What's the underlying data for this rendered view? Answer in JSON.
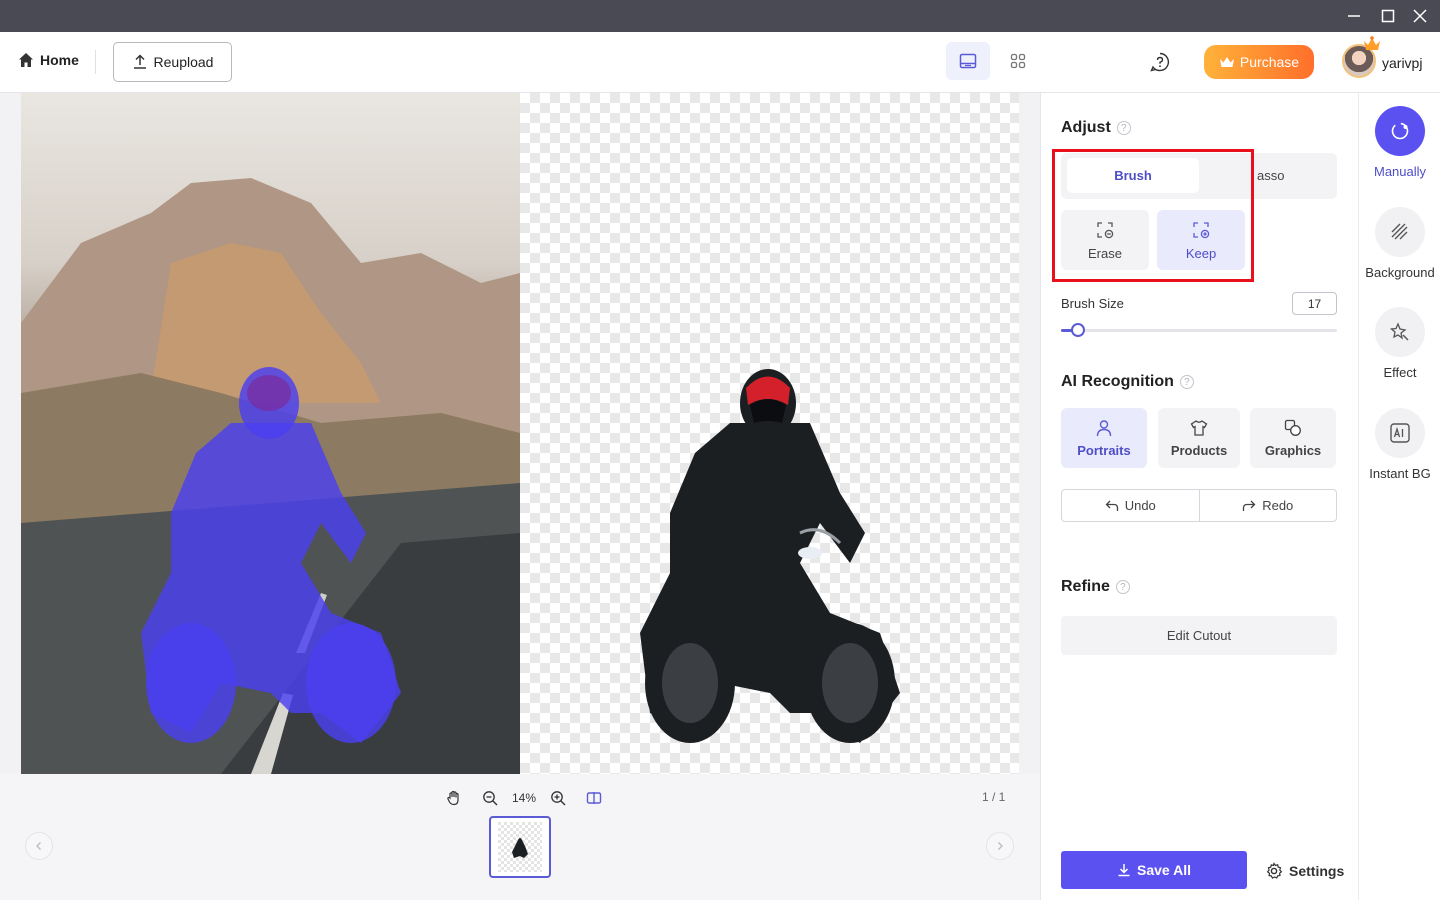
{
  "toolbar": {
    "home_label": "Home",
    "reupload_label": "Reupload",
    "purchase_label": "Purchase",
    "username": "yarivpj"
  },
  "canvas": {
    "zoom": "14%",
    "page_count": "1 / 1"
  },
  "adjust": {
    "title": "Adjust",
    "tabs": [
      {
        "label": "Brush",
        "selected": true
      },
      {
        "label": "asso",
        "selected": false
      }
    ],
    "modes": [
      {
        "label": "Erase",
        "selected": false
      },
      {
        "label": "Keep",
        "selected": true
      }
    ],
    "brush_size_label": "Brush Size",
    "brush_size_value": "17",
    "brush_size_fraction": 0.06
  },
  "ai": {
    "title": "AI Recognition",
    "options": [
      {
        "label": "Portraits",
        "selected": true
      },
      {
        "label": "Products",
        "selected": false
      },
      {
        "label": "Graphics",
        "selected": false
      }
    ],
    "undo_label": "Undo",
    "redo_label": "Redo"
  },
  "refine": {
    "title": "Refine",
    "edit_cutout_label": "Edit Cutout"
  },
  "footer": {
    "save_all_label": "Save All",
    "settings_label": "Settings"
  },
  "sidebar": {
    "items": [
      {
        "label": "Manually",
        "icon": "brush-circle-icon",
        "active": true
      },
      {
        "label": "Background",
        "icon": "hatch-icon",
        "active": false
      },
      {
        "label": "Effect",
        "icon": "sparkle-icon",
        "active": false
      },
      {
        "label": "Instant BG",
        "icon": "ai-image-icon",
        "active": false
      }
    ]
  },
  "colors": {
    "accent": "#5b51f0",
    "purchase_start": "#ffb23a",
    "purchase_end": "#ff6f2a",
    "highlight": "#e8101c",
    "mask_overlay": "#4a40f0"
  }
}
